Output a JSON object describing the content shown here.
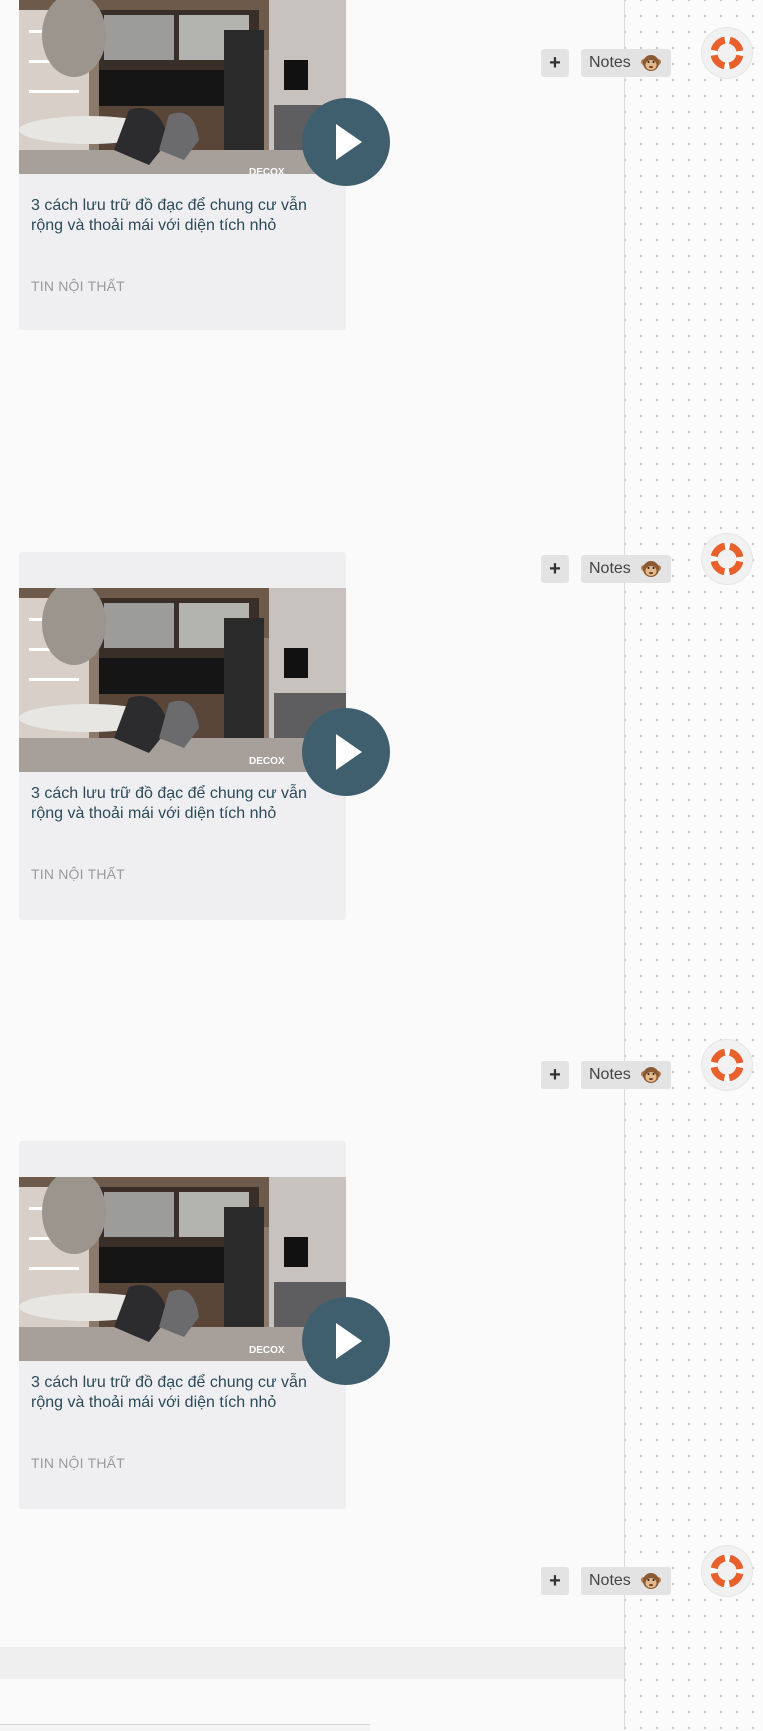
{
  "cards": [
    {
      "title": "3 cách lưu trữ đồ đạc để chung cư vẫn rộng và thoải mái với diện tích nhỏ",
      "category": "TIN NỘI THẤT",
      "image_label": "DECOX"
    },
    {
      "title": "3 cách lưu trữ đồ đạc để chung cư vẫn rộng và thoải mái với diện tích nhỏ",
      "category": "TIN NỘI THẤT",
      "image_label": "DECOX"
    },
    {
      "title": "3 cách lưu trữ đồ đạc để chung cư vẫn rộng và thoải mái với diện tích nhỏ",
      "category": "TIN NỘI THẤT",
      "image_label": "DECOX"
    }
  ],
  "toolbar": {
    "plus_label": "+",
    "notes_label": "Notes"
  },
  "icons": {
    "play": "play-icon",
    "monkey": "monkey-icon",
    "help": "lifebuoy-icon"
  },
  "colors": {
    "play_button": "#3f5f6f",
    "title_text": "#2b4a5a",
    "lifebuoy": "#e8612c"
  }
}
